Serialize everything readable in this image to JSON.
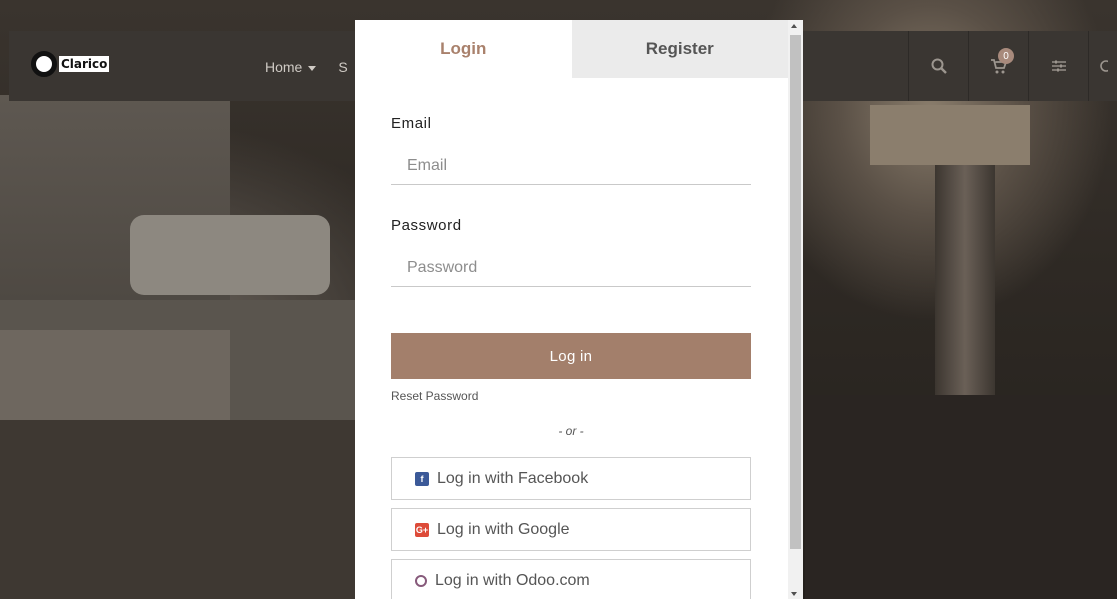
{
  "header": {
    "logo_text": "Clarico",
    "nav_items": [
      {
        "label": "Home"
      },
      {
        "label": "S"
      }
    ],
    "cart_count": "0",
    "icons": [
      "search-icon",
      "cart-icon",
      "filter-icon"
    ]
  },
  "modal": {
    "tabs": [
      {
        "label": "Login",
        "active": true
      },
      {
        "label": "Register",
        "active": false
      }
    ],
    "email": {
      "label": "Email",
      "placeholder": "Email",
      "value": ""
    },
    "password": {
      "label": "Password",
      "placeholder": "Password",
      "value": ""
    },
    "login_button": "Log in",
    "reset_link": "Reset Password",
    "separator": "- or -",
    "social": [
      {
        "label": "Log in with Facebook",
        "icon": "facebook-icon"
      },
      {
        "label": "Log in with Google",
        "icon": "google-plus-icon"
      },
      {
        "label": "Log in with Odoo.com",
        "icon": "odoo-icon"
      }
    ]
  },
  "colors": {
    "accent": "#a37f6b",
    "active_tab_text": "#a9816c",
    "inactive_tab_bg": "#ebebeb",
    "overlay_bg": "#2b2723"
  }
}
